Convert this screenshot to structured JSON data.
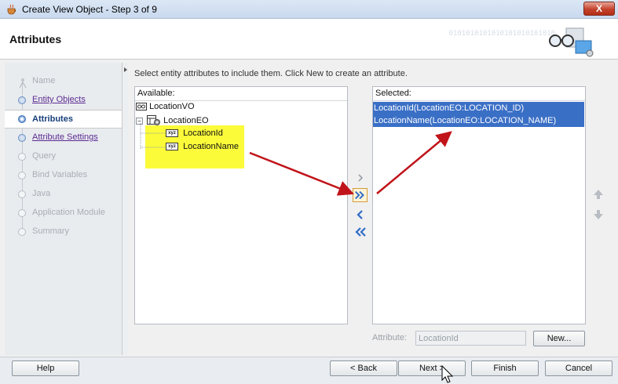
{
  "window": {
    "title": "Create View Object - Step 3 of 9",
    "close_label": "X"
  },
  "header": {
    "title": "Attributes",
    "binary_text": "0101010101010101010101010"
  },
  "nav": {
    "items": [
      {
        "label": "Name",
        "state": "done-plain"
      },
      {
        "label": "Entity Objects",
        "state": "link"
      },
      {
        "label": "Attributes",
        "state": "active"
      },
      {
        "label": "Attribute Settings",
        "state": "link"
      },
      {
        "label": "Query",
        "state": "disabled"
      },
      {
        "label": "Bind Variables",
        "state": "disabled"
      },
      {
        "label": "Java",
        "state": "disabled"
      },
      {
        "label": "Application Module",
        "state": "disabled"
      },
      {
        "label": "Summary",
        "state": "disabled"
      }
    ]
  },
  "main": {
    "instruction": "Select entity attributes to include them.  Click New to create an attribute.",
    "available": {
      "label": "Available:",
      "tree": {
        "root": "LocationVO",
        "entity": "LocationEO",
        "expand_toggle": "−",
        "attributes": [
          "LocationId",
          "LocationName"
        ],
        "attr_icon_text": "xyz"
      }
    },
    "selected": {
      "label": "Selected:",
      "items": [
        "LocationId(LocationEO:LOCATION_ID)",
        "LocationName(LocationEO:LOCATION_NAME)"
      ]
    },
    "attribute_field": {
      "label": "Attribute:",
      "value": "LocationId"
    },
    "new_button": "New..."
  },
  "footer": {
    "help": "Help",
    "back": "< Back",
    "next": "Next >",
    "finish": "Finish",
    "cancel": "Cancel"
  },
  "colors": {
    "selection": "#3a6fc6",
    "highlight": "#fbfb3a",
    "annotation_arrow": "#c0141a"
  }
}
